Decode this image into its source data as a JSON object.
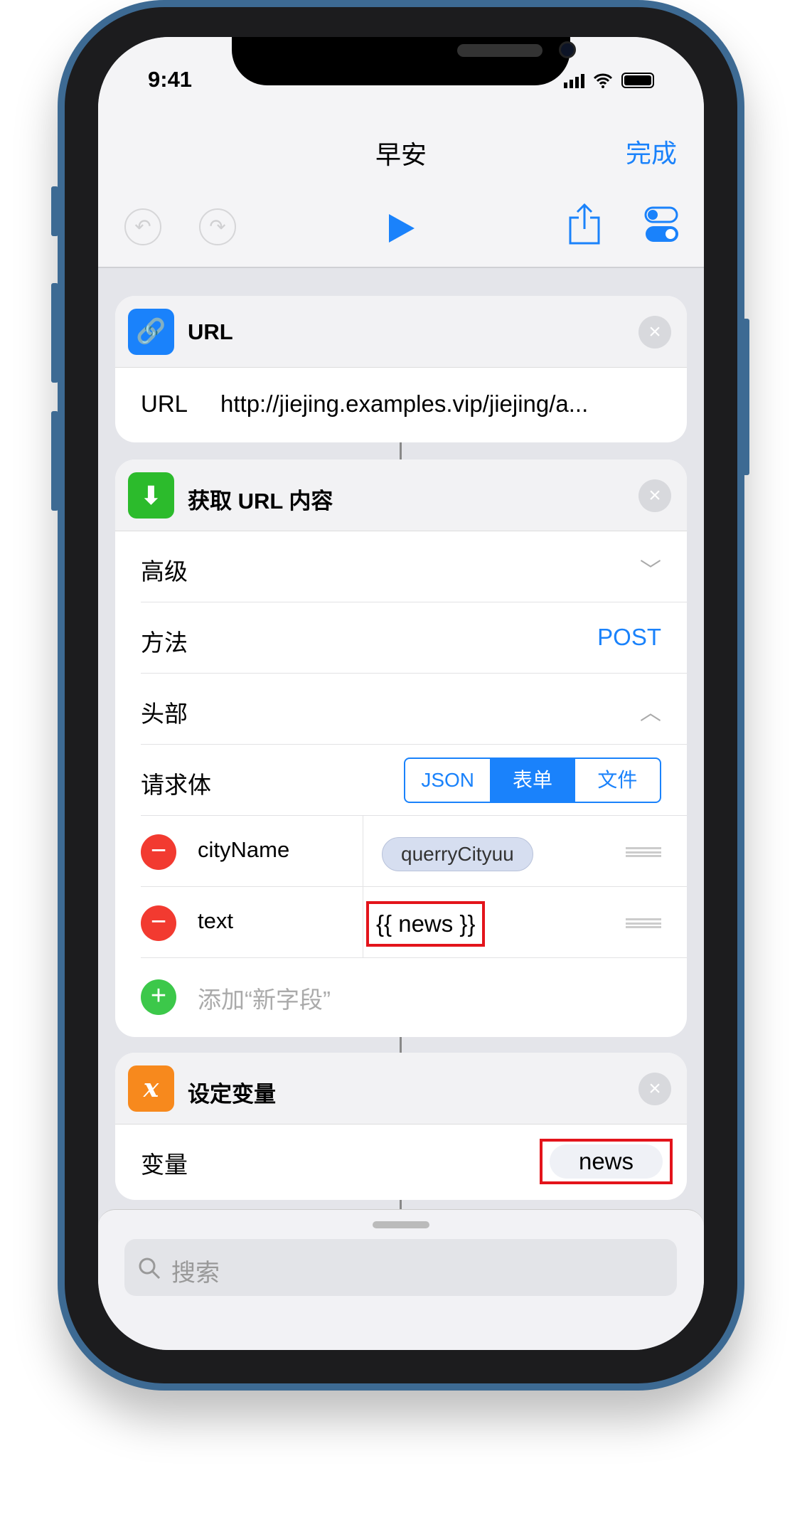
{
  "status": {
    "time": "9:41"
  },
  "nav": {
    "title": "早安",
    "done": "完成"
  },
  "toolbar": {
    "undo": "undo-icon",
    "redo": "redo-icon",
    "play": "play-icon",
    "share": "share-icon",
    "settings": "toggles-icon"
  },
  "actions": [
    {
      "title": "URL",
      "icon": "link-icon",
      "color": "#1a82fb",
      "rows": [
        {
          "label": "URL",
          "value": "http://jiejing.examples.vip/jiejing/a..."
        }
      ]
    },
    {
      "title": "获取 URL 内容",
      "icon": "download-icon",
      "color": "#2cbb2c",
      "advanced": "高级",
      "method_label": "方法",
      "method_value": "POST",
      "headers": "头部",
      "body_label": "请求体",
      "body_options": [
        "JSON",
        "表单",
        "文件"
      ],
      "body_selected": "表单",
      "fields": [
        {
          "key": "cityName",
          "value": "querryCityuu"
        },
        {
          "key": "text",
          "value": "{{ news }}"
        }
      ],
      "add_field": "添加“新字段”"
    },
    {
      "title": "设定变量",
      "icon": "variable-icon",
      "icon_text": "x",
      "color": "#f7891d",
      "var_label": "变量",
      "var_value": "news"
    }
  ],
  "search": {
    "placeholder": "搜索"
  },
  "colors": {
    "accent": "#1a82fb",
    "highlight": "#e3141b"
  }
}
